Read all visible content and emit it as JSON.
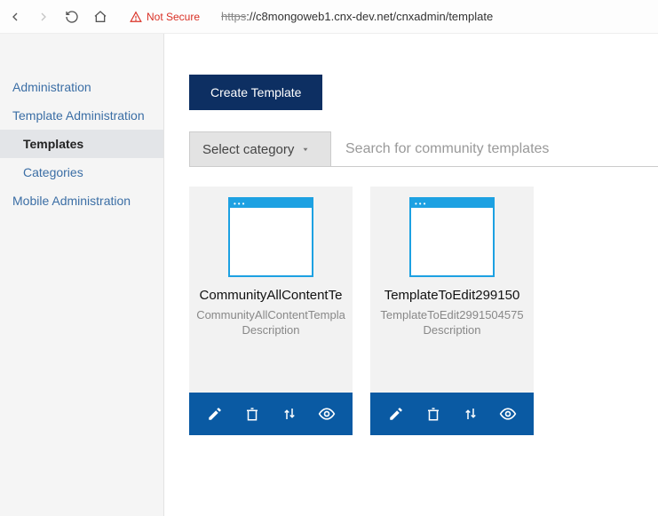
{
  "browser": {
    "security_label": "Not Secure",
    "url_strike": "https",
    "url_rest": "://c8mongoweb1.cnx-dev.net/cnxadmin/template"
  },
  "sidebar": {
    "items": [
      {
        "label": "Administration",
        "sub": false,
        "active": false
      },
      {
        "label": "Template Administration",
        "sub": false,
        "active": false
      },
      {
        "label": "Templates",
        "sub": true,
        "active": true
      },
      {
        "label": "Categories",
        "sub": true,
        "active": false
      },
      {
        "label": "Mobile Administration",
        "sub": false,
        "active": false
      }
    ]
  },
  "main": {
    "create_button": "Create Template",
    "category_label": "Select category",
    "search_placeholder": "Search for community templates"
  },
  "cards": [
    {
      "title": "CommunityAllContentTe",
      "desc1": "CommunityAllContentTempla",
      "desc2": "Description"
    },
    {
      "title": "TemplateToEdit299150",
      "desc1": "TemplateToEdit2991504575",
      "desc2": "Description"
    }
  ]
}
